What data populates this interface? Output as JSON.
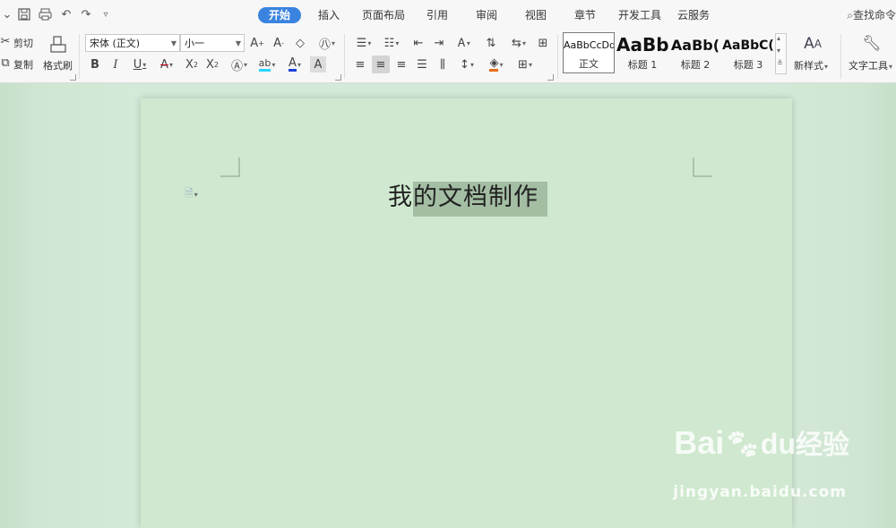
{
  "quick_access": {
    "icons": [
      "chevron-down-icon",
      "save-icon",
      "print-icon",
      "undo-icon",
      "redo-icon",
      "customize-icon"
    ]
  },
  "menu": {
    "tabs": [
      {
        "label": "开始",
        "active": true
      },
      {
        "label": "插入",
        "active": false
      },
      {
        "label": "页面布局",
        "active": false
      },
      {
        "label": "引用",
        "active": false
      },
      {
        "label": "审阅",
        "active": false
      },
      {
        "label": "视图",
        "active": false
      },
      {
        "label": "章节",
        "active": false
      },
      {
        "label": "开发工具",
        "active": false
      },
      {
        "label": "云服务",
        "active": false
      }
    ],
    "search_label": "查找命令",
    "accent_color": "#3a84e0"
  },
  "clipboard": {
    "cut_label": "剪切",
    "copy_label": "复制",
    "format_painter_label": "格式刷"
  },
  "font": {
    "family_value": "宋体 (正文)",
    "size_value": "小一",
    "font_color": "#1f3fd6",
    "highlight_color": "#2ad6ff",
    "underline_color": "#d0021b"
  },
  "styles": {
    "items": [
      {
        "sample": "AaBbCcDd",
        "label": "正文",
        "selected": true
      },
      {
        "sample": "AaBb",
        "label": "标题 1",
        "selected": false
      },
      {
        "sample": "AaBb(",
        "label": "标题 2",
        "selected": false
      },
      {
        "sample": "AaBbC(",
        "label": "标题 3",
        "selected": false
      }
    ],
    "new_style_label": "新样式"
  },
  "tools": {
    "text_tools_label": "文字工具"
  },
  "document": {
    "title_normal": "我",
    "title_selected": "的文档制作",
    "page_color": "#cfe8cf",
    "selection_color": "#a4bea4"
  },
  "watermark": {
    "brand": "Bai",
    "brand_tail": "经验",
    "url": "jingyan.baidu.com"
  }
}
